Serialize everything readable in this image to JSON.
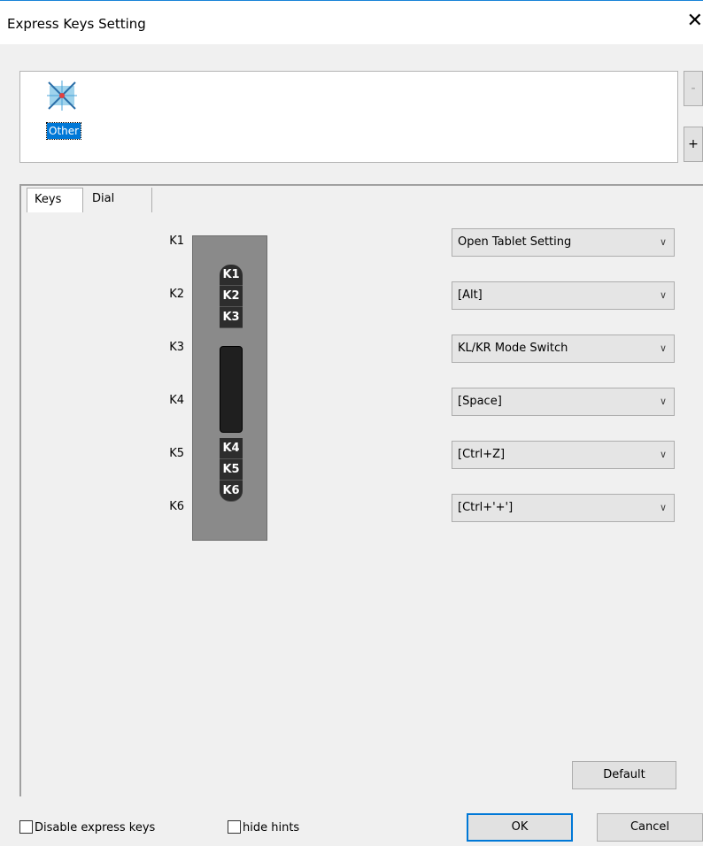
{
  "window": {
    "title": "Express Keys Setting",
    "close_glyph": "✕"
  },
  "app_list": {
    "items": [
      {
        "label": "Other",
        "icon": "other-app-icon",
        "selected": true
      }
    ],
    "remove_label": "-",
    "add_label": "+"
  },
  "tabs": [
    {
      "label": "Keys",
      "active": true
    },
    {
      "label": "Dial",
      "active": false
    }
  ],
  "tablet_keys": [
    "K1",
    "K2",
    "K3",
    "K4",
    "K5",
    "K6"
  ],
  "key_settings": [
    {
      "key": "K1",
      "value": "Open Tablet Setting"
    },
    {
      "key": "K2",
      "value": "[Alt]"
    },
    {
      "key": "K3",
      "value": "KL/KR Mode Switch"
    },
    {
      "key": "K4",
      "value": "[Space]"
    },
    {
      "key": "K5",
      "value": "[Ctrl+Z]"
    },
    {
      "key": "K6",
      "value": "[Ctrl+'+']"
    }
  ],
  "default_label": "Default",
  "footer": {
    "disable_keys_label": "Disable express keys",
    "disable_keys_checked": false,
    "hide_hints_label": "hide hints",
    "hide_hints_checked": false,
    "ok_label": "OK",
    "cancel_label": "Cancel"
  },
  "colors": {
    "accent": "#0078d7",
    "tablet": "#8a8a8a",
    "key_cap": "#2d2d2d"
  }
}
